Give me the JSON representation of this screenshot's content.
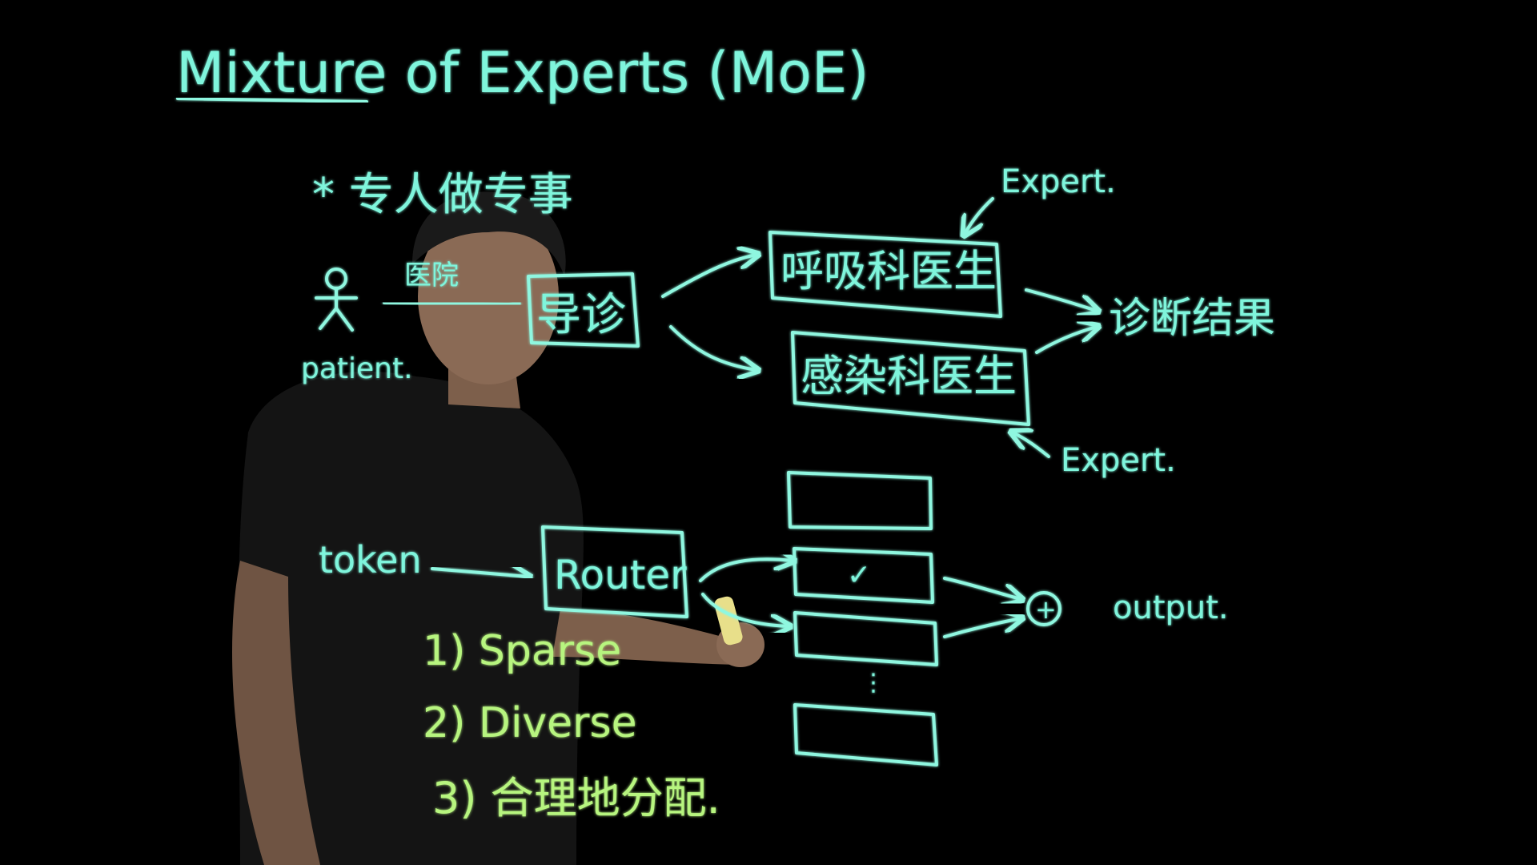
{
  "title": "Mixture of Experts (MoE)",
  "subtitle": "* 专人做专事",
  "patient": {
    "label": "patient.",
    "hospital": "医院"
  },
  "triage": "导诊",
  "experts": {
    "respiratory": "呼吸科医生",
    "infection": "感染科医生",
    "label_top": "Expert.",
    "label_bottom": "Expert."
  },
  "diagnosis": "诊断结果",
  "router_section": {
    "token": "token",
    "router": "Router",
    "sum_symbol": "+",
    "output": "output.",
    "checkmark": "✓",
    "dots": "⋮"
  },
  "properties": [
    "1) Sparse",
    "2) Diverse",
    "3) 合理地分配."
  ],
  "colors": {
    "ink": "#7ff5dc",
    "ink_yellow": "#b7f57f",
    "background": "#000000",
    "shirt": "#141414",
    "skin": "#8a6a55"
  }
}
